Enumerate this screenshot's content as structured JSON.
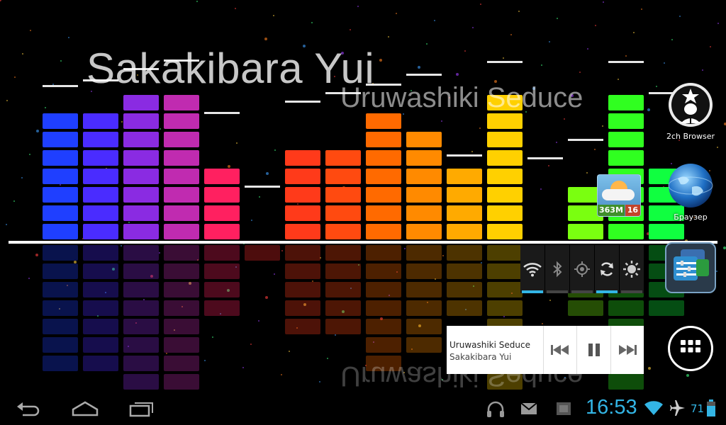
{
  "wallpaper": {
    "artist": "Sakakibara Yui",
    "title": "Uruwashiki Seduce",
    "mirror_title": "Uruwashiki Seduce"
  },
  "shortcuts": [
    {
      "label": "2ch Browser",
      "icon": "anonymous-mask-icon"
    },
    {
      "label": "Браузер",
      "icon": "globe-browser-icon"
    }
  ],
  "weather_widget": {
    "left": "363M",
    "right": "16",
    "icon": "sun-cloud-icon"
  },
  "quick_toggles": [
    {
      "name": "wifi",
      "on": true
    },
    {
      "name": "bluetooth",
      "on": false
    },
    {
      "name": "gps",
      "on": false
    },
    {
      "name": "sync",
      "on": true
    },
    {
      "name": "brightness",
      "on": false
    }
  ],
  "music_widget": {
    "title": "Uruwashiki Seduce",
    "artist": "Sakakibara Yui",
    "controls": [
      "previous",
      "pause",
      "next"
    ]
  },
  "status_bar": {
    "time": "16:53",
    "battery_level": "71",
    "icons": [
      "headphones-icon",
      "mail-icon",
      "notification-icon",
      "wifi-icon",
      "airplane-icon",
      "battery-icon"
    ]
  },
  "colors": {
    "accent": "#33b5e5"
  }
}
